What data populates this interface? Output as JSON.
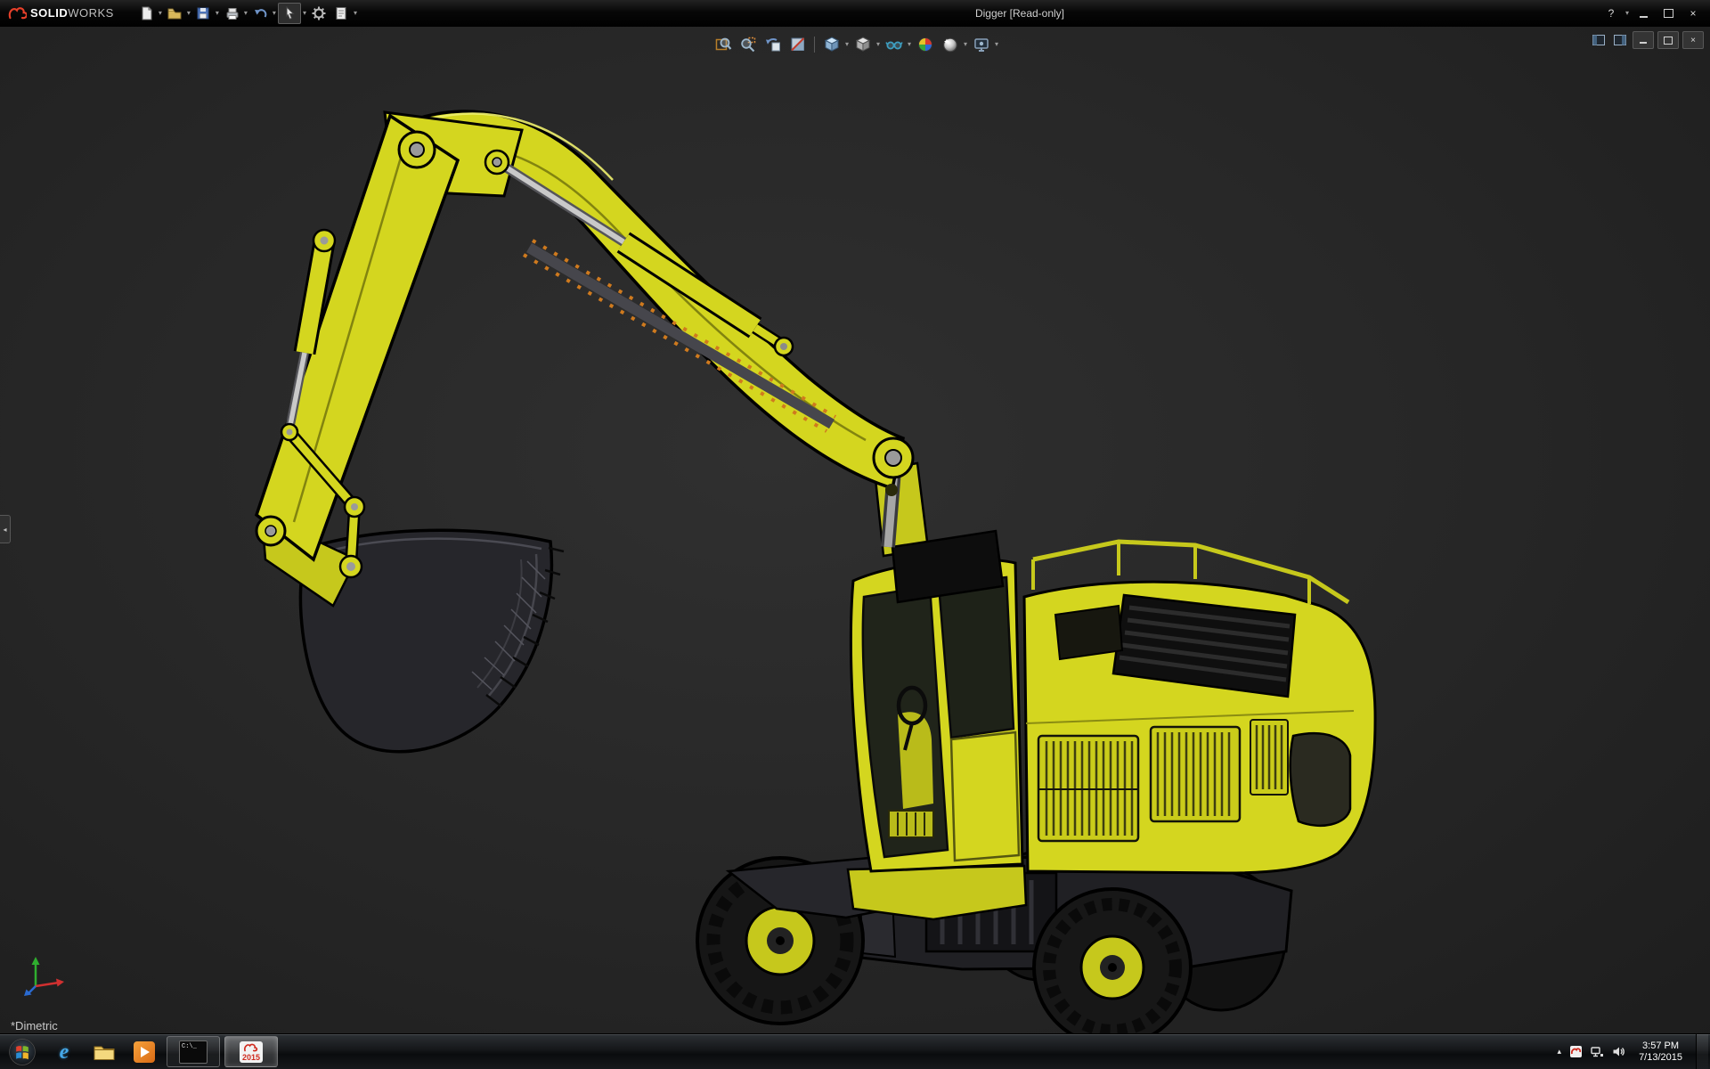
{
  "window": {
    "title": "Digger [Read-only]",
    "logo_bold": "SOLID",
    "logo_light": "WORKS"
  },
  "glyphs": {
    "caret_down": "▾",
    "help": "?",
    "close": "×",
    "collapse_tab": "◂",
    "tray_expand": "▴",
    "ie": "e",
    "cmd": "C:\\_"
  },
  "main_toolbar_icons": [
    "new-document",
    "open",
    "save",
    "print",
    "undo",
    "select",
    "options-gear",
    "document-properties"
  ],
  "heads_up_toolbar_icons": [
    "zoom-to-fit",
    "zoom-to-area",
    "previous-view",
    "section-view",
    "view-orientation",
    "display-style",
    "hide-show-items",
    "edit-appearance",
    "apply-scene",
    "view-settings"
  ],
  "viewport": {
    "orientation_label": "*Dimetric",
    "model_name": "digger-excavator",
    "model_color": "#d4d61f"
  },
  "taskbar": {
    "solidworks_badge": "2015",
    "tray_time": "3:57 PM",
    "tray_date": "7/13/2015"
  }
}
